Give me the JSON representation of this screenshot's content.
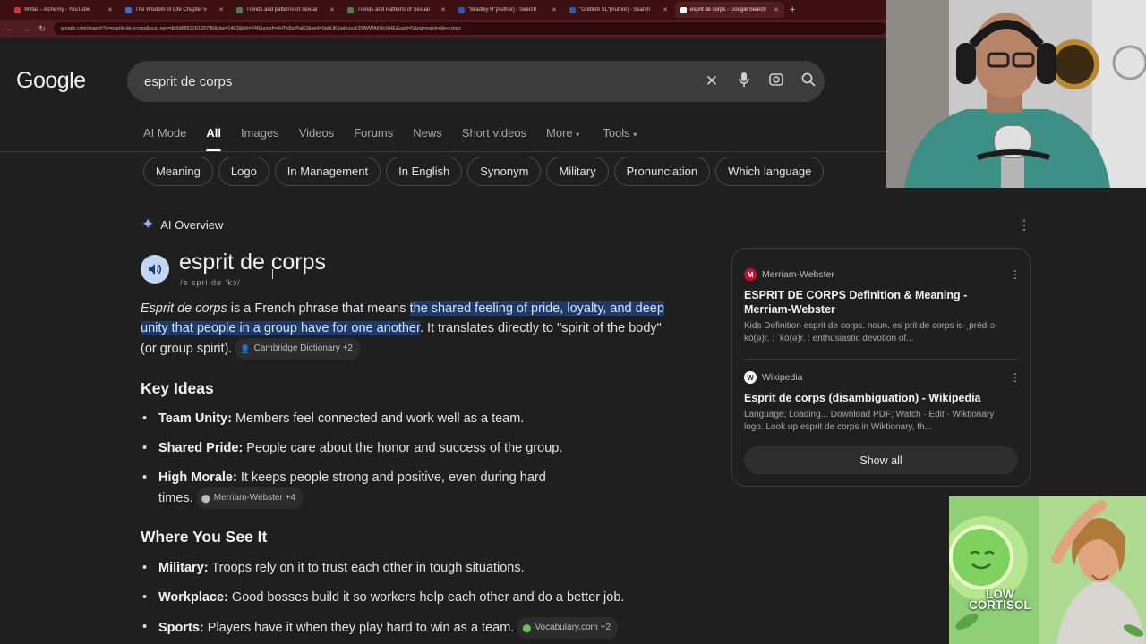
{
  "browser": {
    "tabs": [
      {
        "title": "Wiltas - Alchemy - YouTube",
        "active": false
      },
      {
        "title": "The Wisdom of Life Chapter 5",
        "active": false
      },
      {
        "title": "Trends and patterns of sexual",
        "active": false
      },
      {
        "title": "Trends and Patterns of Sexual",
        "active": false
      },
      {
        "title": "\"Bradley H\"[Author] - Search",
        "active": false
      },
      {
        "title": "\"Gottlieb SL\"[Author] - Search",
        "active": false
      },
      {
        "title": "esprit de corps - Google Search",
        "active": true
      }
    ],
    "url": "google.com/search?q=esprit+de+corps&sca_esv=db9d685226129798&biw=1463&bih=746&sxsrf=AHTn8zrPaR2&ved=0ahUKEwjIvuuX2i9WWAkWchHE&uact=5&oq=esprit+de+corps"
  },
  "google": {
    "logo": "Google",
    "query": "esprit de corps",
    "tabs": [
      {
        "label": "AI Mode",
        "active": false
      },
      {
        "label": "All",
        "active": true
      },
      {
        "label": "Images",
        "active": false
      },
      {
        "label": "Videos",
        "active": false
      },
      {
        "label": "Forums",
        "active": false
      },
      {
        "label": "News",
        "active": false
      },
      {
        "label": "Short videos",
        "active": false
      },
      {
        "label": "More",
        "active": false
      },
      {
        "label": "Tools",
        "active": false
      }
    ],
    "chips": [
      "Meaning",
      "Logo",
      "In Management",
      "In English",
      "Synonym",
      "Military",
      "Pronunciation",
      "Which language"
    ]
  },
  "overview": {
    "label": "AI Overview",
    "term": "esprit de corps",
    "pronunciation": "/e spri de 'kɔ/",
    "intro_term": "Esprit de corps",
    "intro_mid": " is a French phrase that means ",
    "intro_highlight": "the shared feeling of pride, loyalty, and deep unity that people in a group have for one another",
    "intro_end": ". It translates directly to \"spirit of the body\" (or group spirit).",
    "intro_cite": "Cambridge Dictionary +2",
    "key_ideas_heading": "Key Ideas",
    "key_ideas": [
      {
        "term": "Team Unity:",
        "text": " Members feel connected and work well as a team.",
        "cite": ""
      },
      {
        "term": "Shared Pride:",
        "text": " People care about the honor and success of the group.",
        "cite": ""
      },
      {
        "term": "High Morale:",
        "text": " It keeps people strong and positive, even during hard times.",
        "cite": "Merriam-Webster +4"
      }
    ],
    "where_heading": "Where You See It",
    "where": [
      {
        "term": "Military:",
        "text": " Troops rely on it to trust each other in tough situations.",
        "cite": ""
      },
      {
        "term": "Workplace:",
        "text": " Good bosses build it so workers help each other and do a better job.",
        "cite": ""
      },
      {
        "term": "Sports:",
        "text": " Players have it when they play hard to win as a team.",
        "cite": "Vocabulary.com +2"
      }
    ]
  },
  "sources": [
    {
      "site": "Merriam-Webster",
      "title": "ESPRIT DE CORPS Definition & Meaning - Merriam-Webster",
      "snippet": "Kids Definition esprit de corps. noun. es·prit de corps is-ˌprēd-ə- kō(ə)r. : ˈkō(ə)r. : enthusiastic devotion of...",
      "icon_color": "#c8102e"
    },
    {
      "site": "Wikipedia",
      "title": "Esprit de corps (disambiguation) - Wikipedia",
      "snippet": "Language; Loading... Download PDF; Watch · Edit · Wiktionary logo. Look up esprit de corps in Wiktionary, th...",
      "icon_color": "#ffffff"
    }
  ],
  "show_all": "Show all",
  "thumbnail": {
    "line1": "LOW",
    "line2": "CORTISOL"
  },
  "colors": {
    "highlight": "#1d3a6b",
    "accent": "#8ab4f8",
    "tab_bar": "#3c0f12"
  }
}
